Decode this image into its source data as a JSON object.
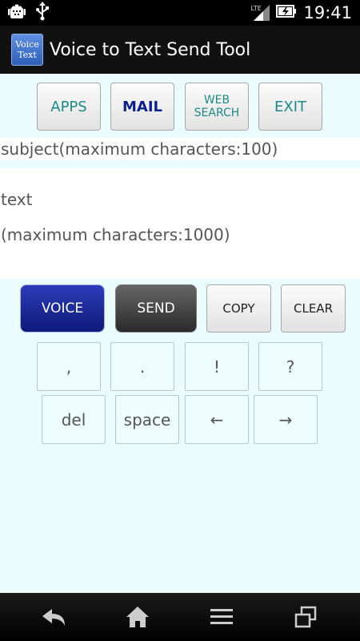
{
  "status_bar": {
    "time": "19:41",
    "network": "LTE",
    "icons": [
      "android-debug-icon",
      "usb-icon",
      "signal-icon",
      "battery-charging-icon"
    ]
  },
  "action_bar": {
    "app_icon_line1": "Voice",
    "app_icon_line2": "Text",
    "title": "Voice to Text Send Tool"
  },
  "top_buttons": {
    "apps": "APPS",
    "mail": "MAIL",
    "web_search_line1": "WEB",
    "web_search_line2": "SEARCH",
    "exit": "EXIT"
  },
  "fields": {
    "subject_placeholder": "subject(maximum characters:100)",
    "text_placeholder_line1": "text",
    "text_placeholder_line2": "(maximum characters:1000)"
  },
  "action_buttons": {
    "voice": "VOICE",
    "send": "SEND",
    "copy": "COPY",
    "clear": "CLEAR"
  },
  "keys": {
    "comma": ",",
    "period": ".",
    "exclaim": "!",
    "question": "?",
    "del": "del",
    "space": "space",
    "left": "←",
    "right": "→"
  },
  "nav_bar": {
    "icons": [
      "back-icon",
      "home-icon",
      "menu-icon",
      "recent-apps-icon"
    ]
  },
  "colors": {
    "background": "#eafcfe",
    "accent_teal": "#1c8a86",
    "accent_navy": "#0d1f8a",
    "voice_button": "#1a2a9a",
    "send_button": "#3a3a3a"
  }
}
